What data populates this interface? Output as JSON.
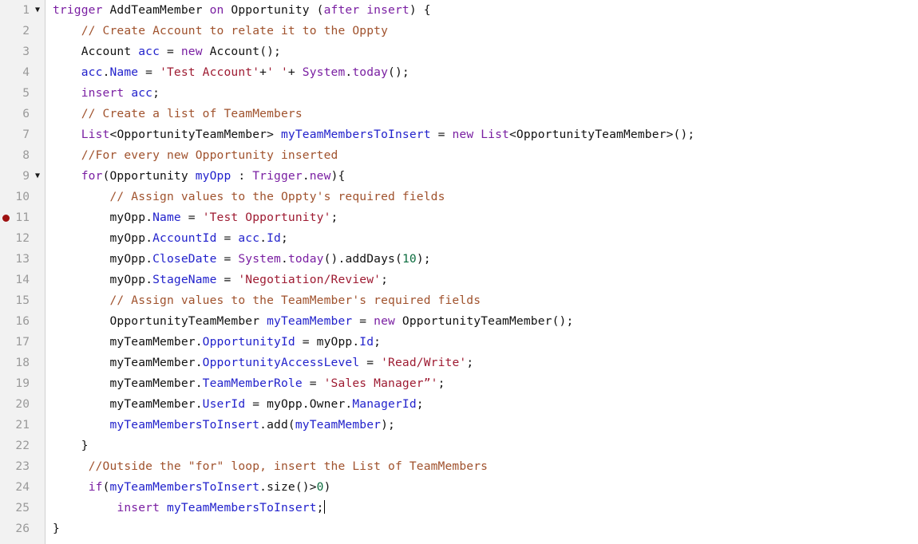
{
  "editor": {
    "language": "Apex",
    "colors": {
      "background": "#ffffff",
      "gutter_background": "#f2f2f2",
      "gutter_border": "#d0d0d0",
      "line_number": "#9a9a9a",
      "keyword": "#7a1fa2",
      "string": "#9e1b32",
      "comment": "#a0522d",
      "variable": "#2222cc",
      "type": "#111111",
      "number": "#0a6b3d",
      "breakpoint": "#9e1111",
      "caret": "#000000"
    },
    "fold_marker_glyph": "▼",
    "total_lines": 26,
    "breakpoint_lines": [
      11
    ],
    "fold_lines": [
      1,
      9
    ],
    "caret_line": 25
  },
  "lines": [
    {
      "n": "1",
      "fold": true,
      "bp": false,
      "text": "trigger AddTeamMember on Opportunity (after insert) {"
    },
    {
      "n": "2",
      "fold": false,
      "bp": false,
      "text": "    // Create Account to relate it to the Oppty"
    },
    {
      "n": "3",
      "fold": false,
      "bp": false,
      "text": "    Account acc = new Account();"
    },
    {
      "n": "4",
      "fold": false,
      "bp": false,
      "text": "    acc.Name = 'Test Account'+' '+ System.today();"
    },
    {
      "n": "5",
      "fold": false,
      "bp": false,
      "text": "    insert acc;"
    },
    {
      "n": "6",
      "fold": false,
      "bp": false,
      "text": "    // Create a list of TeamMembers"
    },
    {
      "n": "7",
      "fold": false,
      "bp": false,
      "text": "    List<OpportunityTeamMember> myTeamMembersToInsert = new List<OpportunityTeamMember>();"
    },
    {
      "n": "8",
      "fold": false,
      "bp": false,
      "text": "    //For every new Opportunity inserted"
    },
    {
      "n": "9",
      "fold": true,
      "bp": false,
      "text": "    for(Opportunity myOpp : Trigger.new){"
    },
    {
      "n": "10",
      "fold": false,
      "bp": false,
      "text": "        // Assign values to the Oppty's required fields"
    },
    {
      "n": "11",
      "fold": false,
      "bp": true,
      "text": "        myOpp.Name = 'Test Opportunity';"
    },
    {
      "n": "12",
      "fold": false,
      "bp": false,
      "text": "        myOpp.AccountId = acc.Id;"
    },
    {
      "n": "13",
      "fold": false,
      "bp": false,
      "text": "        myOpp.CloseDate = System.today().addDays(10);"
    },
    {
      "n": "14",
      "fold": false,
      "bp": false,
      "text": "        myOpp.StageName = 'Negotiation/Review';"
    },
    {
      "n": "15",
      "fold": false,
      "bp": false,
      "text": "        // Assign values to the TeamMember's required fields"
    },
    {
      "n": "16",
      "fold": false,
      "bp": false,
      "text": "        OpportunityTeamMember myTeamMember = new OpportunityTeamMember();"
    },
    {
      "n": "17",
      "fold": false,
      "bp": false,
      "text": "        myTeamMember.OpportunityId = myOpp.Id;"
    },
    {
      "n": "18",
      "fold": false,
      "bp": false,
      "text": "        myTeamMember.OpportunityAccessLevel = 'Read/Write';"
    },
    {
      "n": "19",
      "fold": false,
      "bp": false,
      "text": "        myTeamMember.TeamMemberRole = 'Sales Manager”';"
    },
    {
      "n": "20",
      "fold": false,
      "bp": false,
      "text": "        myTeamMember.UserId = myOpp.Owner.ManagerId;"
    },
    {
      "n": "21",
      "fold": false,
      "bp": false,
      "text": "        myTeamMembersToInsert.add(myTeamMember);"
    },
    {
      "n": "22",
      "fold": false,
      "bp": false,
      "text": "    }"
    },
    {
      "n": "23",
      "fold": false,
      "bp": false,
      "text": "     //Outside the \"for\" loop, insert the List of TeamMembers"
    },
    {
      "n": "24",
      "fold": false,
      "bp": false,
      "text": "     if(myTeamMembersToInsert.size()>0)"
    },
    {
      "n": "25",
      "fold": false,
      "bp": false,
      "text": "         insert myTeamMembersToInsert;"
    },
    {
      "n": "26",
      "fold": false,
      "bp": false,
      "text": "}"
    }
  ],
  "tokens": [
    [
      [
        "kw",
        "trigger"
      ],
      [
        "pun",
        " "
      ],
      [
        "typ",
        "AddTeamMember"
      ],
      [
        "pun",
        " "
      ],
      [
        "kw",
        "on"
      ],
      [
        "pun",
        " "
      ],
      [
        "typ",
        "Opportunity"
      ],
      [
        "pun",
        " ("
      ],
      [
        "kw",
        "after"
      ],
      [
        "pun",
        " "
      ],
      [
        "kw",
        "insert"
      ],
      [
        "pun",
        ") {"
      ]
    ],
    [
      [
        "pun",
        "    "
      ],
      [
        "cmt",
        "// Create Account to relate it to the Oppty"
      ]
    ],
    [
      [
        "pun",
        "    "
      ],
      [
        "typ",
        "Account"
      ],
      [
        "pun",
        " "
      ],
      [
        "var",
        "acc"
      ],
      [
        "pun",
        " = "
      ],
      [
        "kw",
        "new"
      ],
      [
        "pun",
        " "
      ],
      [
        "typ",
        "Account"
      ],
      [
        "pun",
        "();"
      ]
    ],
    [
      [
        "pun",
        "    "
      ],
      [
        "var",
        "acc"
      ],
      [
        "pun",
        "."
      ],
      [
        "var",
        "Name"
      ],
      [
        "pun",
        " = "
      ],
      [
        "str",
        "'Test Account'"
      ],
      [
        "pun",
        "+"
      ],
      [
        "str",
        "' '"
      ],
      [
        "pun",
        "+ "
      ],
      [
        "kw",
        "System"
      ],
      [
        "pun",
        "."
      ],
      [
        "kw",
        "today"
      ],
      [
        "pun",
        "();"
      ]
    ],
    [
      [
        "pun",
        "    "
      ],
      [
        "kw",
        "insert"
      ],
      [
        "pun",
        " "
      ],
      [
        "var",
        "acc"
      ],
      [
        "pun",
        ";"
      ]
    ],
    [
      [
        "pun",
        "    "
      ],
      [
        "cmt",
        "// Create a list of TeamMembers"
      ]
    ],
    [
      [
        "pun",
        "    "
      ],
      [
        "kw",
        "List"
      ],
      [
        "pun",
        "<"
      ],
      [
        "typ",
        "OpportunityTeamMember"
      ],
      [
        "pun",
        "> "
      ],
      [
        "var",
        "myTeamMembersToInsert"
      ],
      [
        "pun",
        " = "
      ],
      [
        "kw",
        "new"
      ],
      [
        "pun",
        " "
      ],
      [
        "kw",
        "List"
      ],
      [
        "pun",
        "<"
      ],
      [
        "typ",
        "OpportunityTeamMember"
      ],
      [
        "pun",
        ">();"
      ]
    ],
    [
      [
        "pun",
        "    "
      ],
      [
        "cmt",
        "//For every new Opportunity inserted"
      ]
    ],
    [
      [
        "pun",
        "    "
      ],
      [
        "kw",
        "for"
      ],
      [
        "pun",
        "("
      ],
      [
        "typ",
        "Opportunity"
      ],
      [
        "pun",
        " "
      ],
      [
        "var",
        "myOpp"
      ],
      [
        "pun",
        " : "
      ],
      [
        "kw",
        "Trigger"
      ],
      [
        "pun",
        "."
      ],
      [
        "kw",
        "new"
      ],
      [
        "pun",
        "){"
      ]
    ],
    [
      [
        "pun",
        "        "
      ],
      [
        "cmt",
        "// Assign values to the Oppty's required fields"
      ]
    ],
    [
      [
        "pun",
        "        "
      ],
      [
        "typ",
        "myOpp"
      ],
      [
        "pun",
        "."
      ],
      [
        "var",
        "Name"
      ],
      [
        "pun",
        " = "
      ],
      [
        "str",
        "'Test Opportunity'"
      ],
      [
        "pun",
        ";"
      ]
    ],
    [
      [
        "pun",
        "        "
      ],
      [
        "typ",
        "myOpp"
      ],
      [
        "pun",
        "."
      ],
      [
        "var",
        "AccountId"
      ],
      [
        "pun",
        " = "
      ],
      [
        "var",
        "acc"
      ],
      [
        "pun",
        "."
      ],
      [
        "var",
        "Id"
      ],
      [
        "pun",
        ";"
      ]
    ],
    [
      [
        "pun",
        "        "
      ],
      [
        "typ",
        "myOpp"
      ],
      [
        "pun",
        "."
      ],
      [
        "var",
        "CloseDate"
      ],
      [
        "pun",
        " = "
      ],
      [
        "kw",
        "System"
      ],
      [
        "pun",
        "."
      ],
      [
        "kw",
        "today"
      ],
      [
        "pun",
        "()."
      ],
      [
        "typ",
        "addDays"
      ],
      [
        "pun",
        "("
      ],
      [
        "num",
        "10"
      ],
      [
        "pun",
        ");"
      ]
    ],
    [
      [
        "pun",
        "        "
      ],
      [
        "typ",
        "myOpp"
      ],
      [
        "pun",
        "."
      ],
      [
        "var",
        "StageName"
      ],
      [
        "pun",
        " = "
      ],
      [
        "str",
        "'Negotiation/Review'"
      ],
      [
        "pun",
        ";"
      ]
    ],
    [
      [
        "pun",
        "        "
      ],
      [
        "cmt",
        "// Assign values to the TeamMember's required fields"
      ]
    ],
    [
      [
        "pun",
        "        "
      ],
      [
        "typ",
        "OpportunityTeamMember"
      ],
      [
        "pun",
        " "
      ],
      [
        "var",
        "myTeamMember"
      ],
      [
        "pun",
        " = "
      ],
      [
        "kw",
        "new"
      ],
      [
        "pun",
        " "
      ],
      [
        "typ",
        "OpportunityTeamMember"
      ],
      [
        "pun",
        "();"
      ]
    ],
    [
      [
        "pun",
        "        "
      ],
      [
        "typ",
        "myTeamMember"
      ],
      [
        "pun",
        "."
      ],
      [
        "var",
        "OpportunityId"
      ],
      [
        "pun",
        " = "
      ],
      [
        "typ",
        "myOpp"
      ],
      [
        "pun",
        "."
      ],
      [
        "var",
        "Id"
      ],
      [
        "pun",
        ";"
      ]
    ],
    [
      [
        "pun",
        "        "
      ],
      [
        "typ",
        "myTeamMember"
      ],
      [
        "pun",
        "."
      ],
      [
        "var",
        "OpportunityAccessLevel"
      ],
      [
        "pun",
        " = "
      ],
      [
        "str",
        "'Read/Write'"
      ],
      [
        "pun",
        ";"
      ]
    ],
    [
      [
        "pun",
        "        "
      ],
      [
        "typ",
        "myTeamMember"
      ],
      [
        "pun",
        "."
      ],
      [
        "var",
        "TeamMemberRole"
      ],
      [
        "pun",
        " = "
      ],
      [
        "str",
        "'Sales Manager”'"
      ],
      [
        "pun",
        ";"
      ]
    ],
    [
      [
        "pun",
        "        "
      ],
      [
        "typ",
        "myTeamMember"
      ],
      [
        "pun",
        "."
      ],
      [
        "var",
        "UserId"
      ],
      [
        "pun",
        " = "
      ],
      [
        "typ",
        "myOpp"
      ],
      [
        "pun",
        ".Owner."
      ],
      [
        "var",
        "ManagerId"
      ],
      [
        "pun",
        ";"
      ]
    ],
    [
      [
        "pun",
        "        "
      ],
      [
        "var",
        "myTeamMembersToInsert"
      ],
      [
        "pun",
        "."
      ],
      [
        "typ",
        "add"
      ],
      [
        "pun",
        "("
      ],
      [
        "var",
        "myTeamMember"
      ],
      [
        "pun",
        ");"
      ]
    ],
    [
      [
        "pun",
        "    }"
      ]
    ],
    [
      [
        "pun",
        "     "
      ],
      [
        "cmt",
        "//Outside the \"for\" loop, insert the List of TeamMembers"
      ]
    ],
    [
      [
        "pun",
        "     "
      ],
      [
        "kw",
        "if"
      ],
      [
        "pun",
        "("
      ],
      [
        "var",
        "myTeamMembersToInsert"
      ],
      [
        "pun",
        "."
      ],
      [
        "typ",
        "size"
      ],
      [
        "pun",
        "()>"
      ],
      [
        "num",
        "0"
      ],
      [
        "pun",
        ")"
      ]
    ],
    [
      [
        "pun",
        "         "
      ],
      [
        "kw",
        "insert"
      ],
      [
        "pun",
        " "
      ],
      [
        "var",
        "myTeamMembersToInsert"
      ],
      [
        "pun",
        ";"
      ]
    ],
    [
      [
        "pun",
        "}"
      ]
    ]
  ]
}
